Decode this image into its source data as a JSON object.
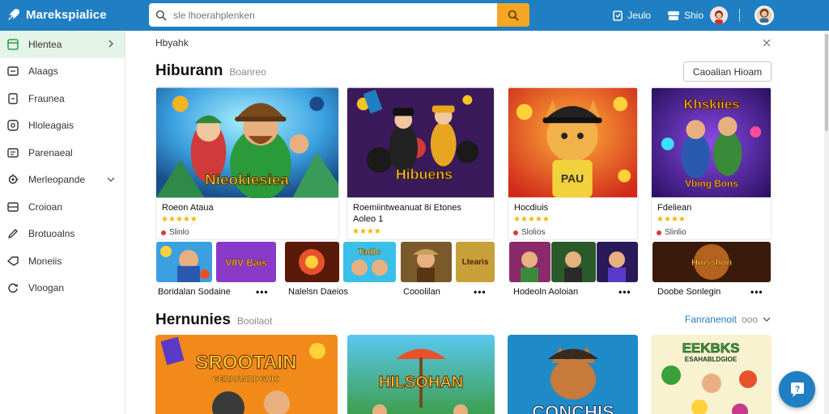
{
  "topbar": {
    "app_title": "Marekspialice",
    "search_placeholder": "sle lhoerahplenken",
    "action1_label": "Jeulo",
    "action2_label": "Shio",
    "brand_color": "#1f7fc2",
    "search_button_color": "#f5a623"
  },
  "sidebar": {
    "items": [
      {
        "label": "Hlentea",
        "icon": "grid-icon",
        "active": true
      },
      {
        "label": "Alaags",
        "icon": "list-icon"
      },
      {
        "label": "Fraunea",
        "icon": "document-icon"
      },
      {
        "label": "Hloleagais",
        "icon": "box-icon"
      },
      {
        "label": "Parenaeal",
        "icon": "notes-icon"
      },
      {
        "label": "Merleopande",
        "icon": "gear-icon"
      },
      {
        "label": "Croioan",
        "icon": "stack-icon"
      },
      {
        "label": "Brotuoalns",
        "icon": "pencil-icon"
      },
      {
        "label": "Moneiis",
        "icon": "tag-icon"
      },
      {
        "label": "Vloogan",
        "icon": "refresh-icon"
      }
    ]
  },
  "main": {
    "breadcrumb": "Hbyahk",
    "section1": {
      "title": "Hiburann",
      "subtitle": "Boanreo",
      "button_label": "Caoalian Hioam"
    },
    "cards": [
      {
        "title": "Roeon Ataua",
        "sub": "",
        "stars": "★★★★★",
        "meta": "Slinlo",
        "art_text": "Nieokiesiea"
      },
      {
        "title": "Roemiintweanuat 8i Etones",
        "sub": "Aoleo 1",
        "stars": "★★★★",
        "meta": "",
        "art_text": "Hibuens"
      },
      {
        "title": "Hocdiuis",
        "sub": "",
        "stars": "★★★★★",
        "meta": "Slolios",
        "art_text": "PAU"
      },
      {
        "title": "Fdeliean",
        "sub": "",
        "stars": "★★★★",
        "meta": "Slinlio",
        "art_text": "Khskiies",
        "art_text2": "Vbing Bons"
      }
    ],
    "mini_rows": [
      {
        "caption": "Boridalan Sodaine",
        "dots": "•••",
        "tile_texts": [
          "",
          "VIIV Bais"
        ]
      },
      {
        "caption": "Nalelsn Daeios",
        "dots": "",
        "tile_texts": [
          "",
          "Tadlc"
        ]
      },
      {
        "caption": "Cooolilan",
        "dots": "•••",
        "tile_texts": [
          "",
          "Ltearis"
        ]
      },
      {
        "caption": "Hodeoln Aoloian",
        "dots": "•••",
        "tile_texts": [
          "",
          "",
          ""
        ]
      },
      {
        "caption": "Doobe Sonlegin",
        "dots": "•••",
        "tile_texts": [
          "Hmsshon"
        ]
      }
    ],
    "section2": {
      "title": "Hernunies",
      "subtitle": "Booilaot",
      "link_label": "Fanranenoit",
      "link_note": "ooo"
    },
    "bottom_cards": [
      {
        "art_text": "SROOTAIN",
        "art_sub": "GERNANRDGHIO"
      },
      {
        "art_text": "HILSOHAN"
      },
      {
        "art_text": "CONCHIS"
      },
      {
        "art_text": "EEKBKS",
        "art_sub": "ESAHABLDGIOE"
      }
    ]
  }
}
